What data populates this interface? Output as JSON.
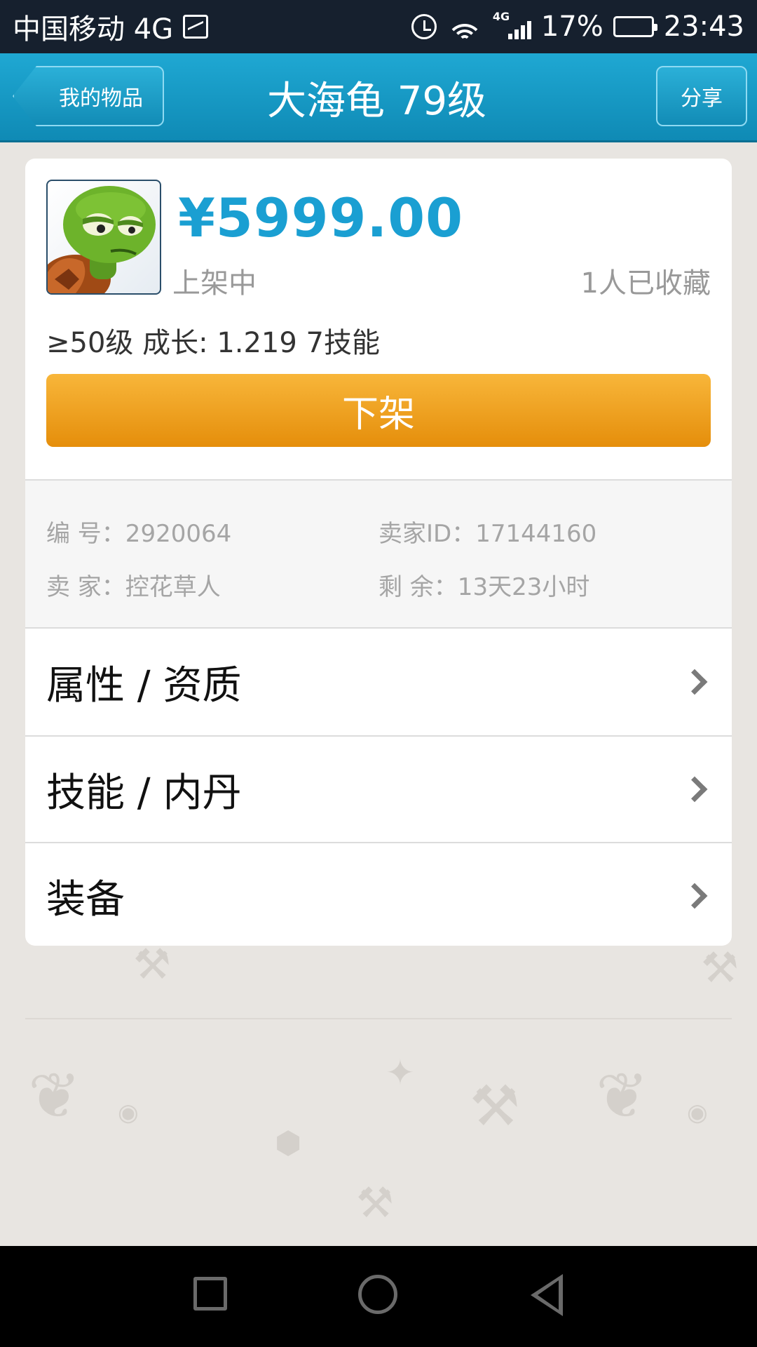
{
  "status_bar": {
    "carrier": "中国移动 4G",
    "signal_tag": "4G",
    "battery": "17%",
    "time": "23:43"
  },
  "nav": {
    "back_label": "我的物品",
    "title": "大海龟 79级",
    "share_label": "分享"
  },
  "item": {
    "price": "¥5999.00",
    "status": "上架中",
    "favorites": "1人已收藏",
    "summary": "≥50级 成长: 1.219  7技能",
    "offshelf_label": "下架",
    "avatar_icon": "sea-turtle-avatar"
  },
  "info": {
    "serial": "编  号：2920064",
    "seller_id": "卖家ID：17144160",
    "seller": "卖  家：控花草人",
    "remaining": "剩  余：13天23小时"
  },
  "rows": [
    {
      "label": "属性 / 资质"
    },
    {
      "label": "技能 / 内丹"
    },
    {
      "label": "装备"
    }
  ],
  "colors": {
    "accent": "#1a9fd2",
    "button": "#f0a21f",
    "nav": "#1a9dc8"
  }
}
